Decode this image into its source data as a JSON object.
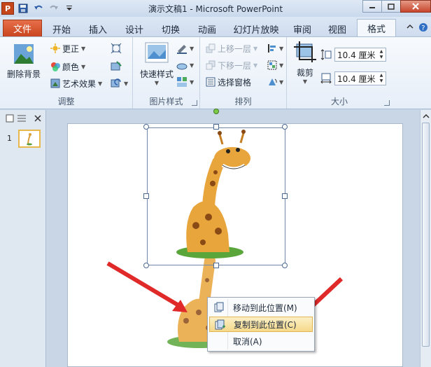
{
  "window": {
    "title": "演示文稿1 - Microsoft PowerPoint",
    "app_icon_letter": "P"
  },
  "tabs": {
    "file": "文件",
    "items": [
      "开始",
      "插入",
      "设计",
      "切换",
      "动画",
      "幻灯片放映",
      "审阅",
      "视图",
      "格式"
    ],
    "active": "格式"
  },
  "ribbon": {
    "adjust": {
      "label": "调整",
      "remove_bg": "删除背景",
      "corrections": "更正",
      "color": "颜色",
      "artistic": "艺术效果"
    },
    "styles": {
      "label": "图片样式",
      "quick_styles": "快速样式"
    },
    "arrange": {
      "label": "排列",
      "bring_forward": "上移一层",
      "send_backward": "下移一层",
      "selection_pane": "选择窗格"
    },
    "size": {
      "label": "大小",
      "crop": "裁剪",
      "height": "10.4 厘米",
      "width": "10.4 厘米"
    }
  },
  "slides_panel": {
    "slide_number": "1"
  },
  "context_menu": {
    "items": [
      {
        "label": "移动到此位置(M)"
      },
      {
        "label": "复制到此位置(C)"
      },
      {
        "label": "取消(A)"
      }
    ],
    "highlighted_index": 1
  },
  "colors": {
    "file_tab": "#c9451f",
    "arrow_red": "#e02a2a",
    "menu_highlight": "#f5d98a"
  }
}
